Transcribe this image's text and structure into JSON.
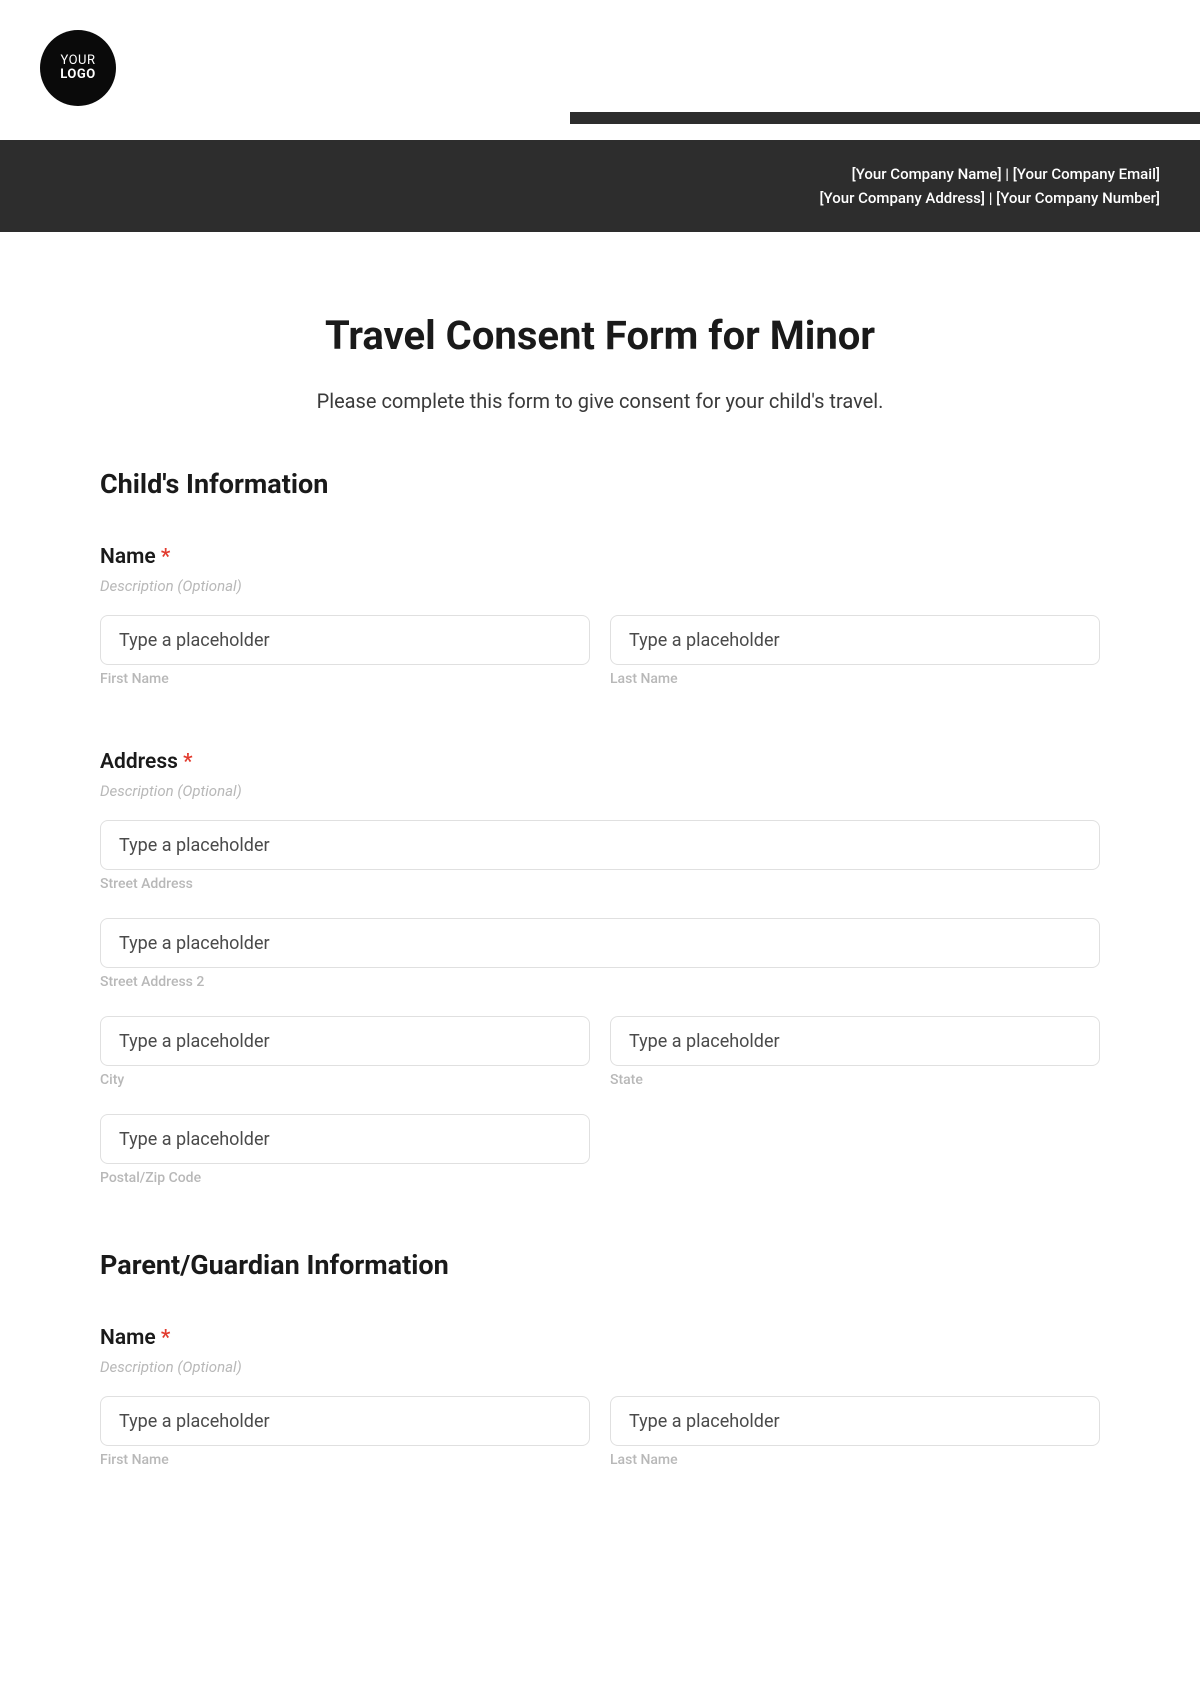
{
  "logo": {
    "line1": "YOUR",
    "line2": "LOGO"
  },
  "header": {
    "line1": "[Your Company Name] | [Your Company Email]",
    "line2": "[Your Company Address] | [Your Company Number]"
  },
  "title": "Travel Consent Form for Minor",
  "subtitle": "Please complete this form to give consent for your child's travel.",
  "sections": {
    "child": {
      "heading": "Child's Information",
      "name": {
        "label": "Name",
        "required": "*",
        "description": "Description (Optional)",
        "first": {
          "placeholder": "Type a placeholder",
          "sublabel": "First Name"
        },
        "last": {
          "placeholder": "Type a placeholder",
          "sublabel": "Last Name"
        }
      },
      "address": {
        "label": "Address",
        "required": "*",
        "description": "Description (Optional)",
        "street": {
          "placeholder": "Type a placeholder",
          "sublabel": "Street Address"
        },
        "street2": {
          "placeholder": "Type a placeholder",
          "sublabel": "Street Address 2"
        },
        "city": {
          "placeholder": "Type a placeholder",
          "sublabel": "City"
        },
        "state": {
          "placeholder": "Type a placeholder",
          "sublabel": "State"
        },
        "postal": {
          "placeholder": "Type a placeholder",
          "sublabel": "Postal/Zip Code"
        }
      }
    },
    "guardian": {
      "heading": "Parent/Guardian Information",
      "name": {
        "label": "Name",
        "required": "*",
        "description": "Description (Optional)",
        "first": {
          "placeholder": "Type a placeholder",
          "sublabel": "First Name"
        },
        "last": {
          "placeholder": "Type a placeholder",
          "sublabel": "Last Name"
        }
      }
    }
  }
}
